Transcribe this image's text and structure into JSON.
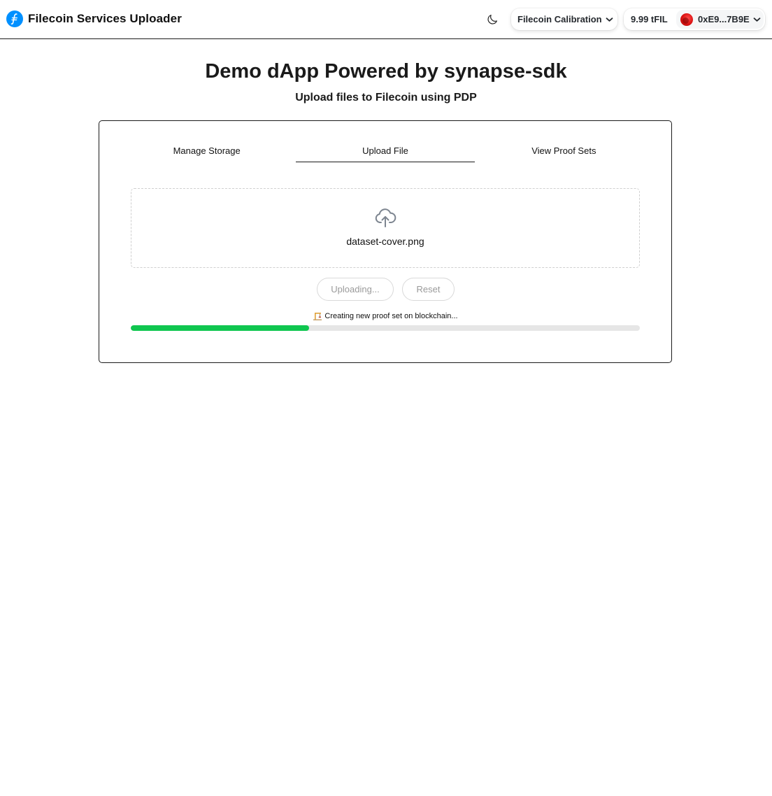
{
  "header": {
    "app_title": "Filecoin Services Uploader",
    "logo_icon": "filecoin-logo",
    "theme_icon": "moon-icon",
    "network": {
      "label": "Filecoin Calibration",
      "icon": "chevron-down-icon"
    },
    "account": {
      "balance": "9.99 tFIL",
      "address": "0xE9...7B9E",
      "icon": "chevron-down-icon"
    }
  },
  "main": {
    "title": "Demo dApp Powered by synapse-sdk",
    "subtitle": "Upload files to Filecoin using PDP",
    "tabs": [
      {
        "label": "Manage Storage",
        "active": false
      },
      {
        "label": "Upload File",
        "active": true
      },
      {
        "label": "View Proof Sets",
        "active": false
      }
    ],
    "dropzone": {
      "icon": "cloud-upload-icon",
      "file_name": "dataset-cover.png"
    },
    "buttons": {
      "upload_label": "Uploading...",
      "reset_label": "Reset"
    },
    "status": {
      "icon": "construction-icon",
      "text": "Creating new proof set on blockchain..."
    },
    "progress": {
      "fraction": 0.35,
      "color": "#0fc64f",
      "track_color": "#e6e6e6"
    }
  },
  "colors": {
    "brand": "#0090ff",
    "text": "#111111",
    "border": "#1a1a1a"
  }
}
